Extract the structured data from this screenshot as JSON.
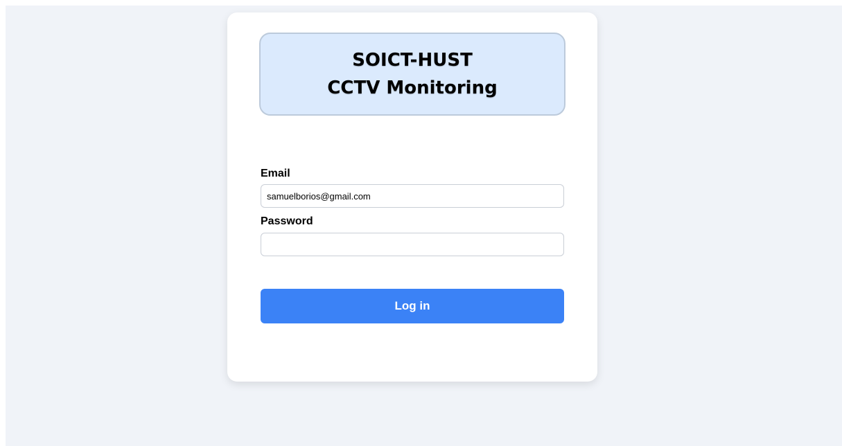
{
  "header": {
    "title_line1": "SOICT-HUST",
    "title_line2": "CCTV Monitoring"
  },
  "form": {
    "email_label": "Email",
    "email_value": "samuelborios@gmail.com",
    "password_label": "Password",
    "password_value": "",
    "login_label": "Log in"
  },
  "colors": {
    "background": "#f0f3f8",
    "title_box_fill": "#dbeafd",
    "title_box_border": "#bccadb",
    "button": "#3b82f6"
  }
}
